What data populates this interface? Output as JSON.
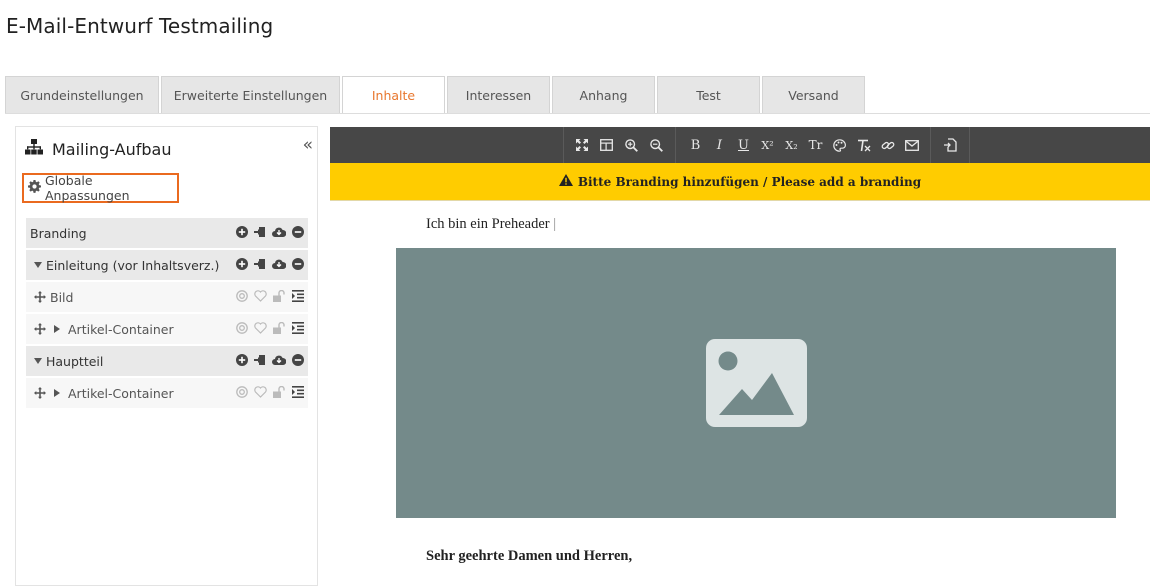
{
  "page": {
    "title": "E-Mail-Entwurf Testmailing"
  },
  "tabs": [
    {
      "label": "Grundeinstellungen",
      "active": false
    },
    {
      "label": "Erweiterte Einstellungen",
      "active": false
    },
    {
      "label": "Inhalte",
      "active": true
    },
    {
      "label": "Interessen",
      "active": false
    },
    {
      "label": "Anhang",
      "active": false
    },
    {
      "label": "Test",
      "active": false
    },
    {
      "label": "Versand",
      "active": false
    }
  ],
  "sidebar": {
    "title": "Mailing-Aufbau",
    "collapse_glyph": "«",
    "global_button": "Globale Anpassungen",
    "tree": [
      {
        "label": "Branding",
        "kind": "group"
      },
      {
        "label": "Einleitung (vor Inhaltsverz.)",
        "kind": "group"
      },
      {
        "label": "Bild",
        "kind": "item"
      },
      {
        "label": "Artikel-Container",
        "kind": "item"
      },
      {
        "label": "Hauptteil",
        "kind": "group"
      },
      {
        "label": "Artikel-Container",
        "kind": "item"
      }
    ]
  },
  "editor": {
    "toolbar": {
      "bold": "B",
      "italic": "I",
      "underline": "U",
      "superscript": "X²",
      "subscript": "X₂",
      "text_style": "Tr"
    },
    "warning": "Bitte Branding hinzufügen / Please add a branding",
    "preheader": "Ich bin ein Preheader",
    "preheader_cursor": "|",
    "greeting": "Sehr geehrte Damen und Herren,"
  },
  "colors": {
    "accent": "#e8772e",
    "highlight_border": "#ea6a1f",
    "toolbar_bg": "#474747",
    "warning_bg": "#ffcc00",
    "image_placeholder_bg": "#748a8a"
  }
}
